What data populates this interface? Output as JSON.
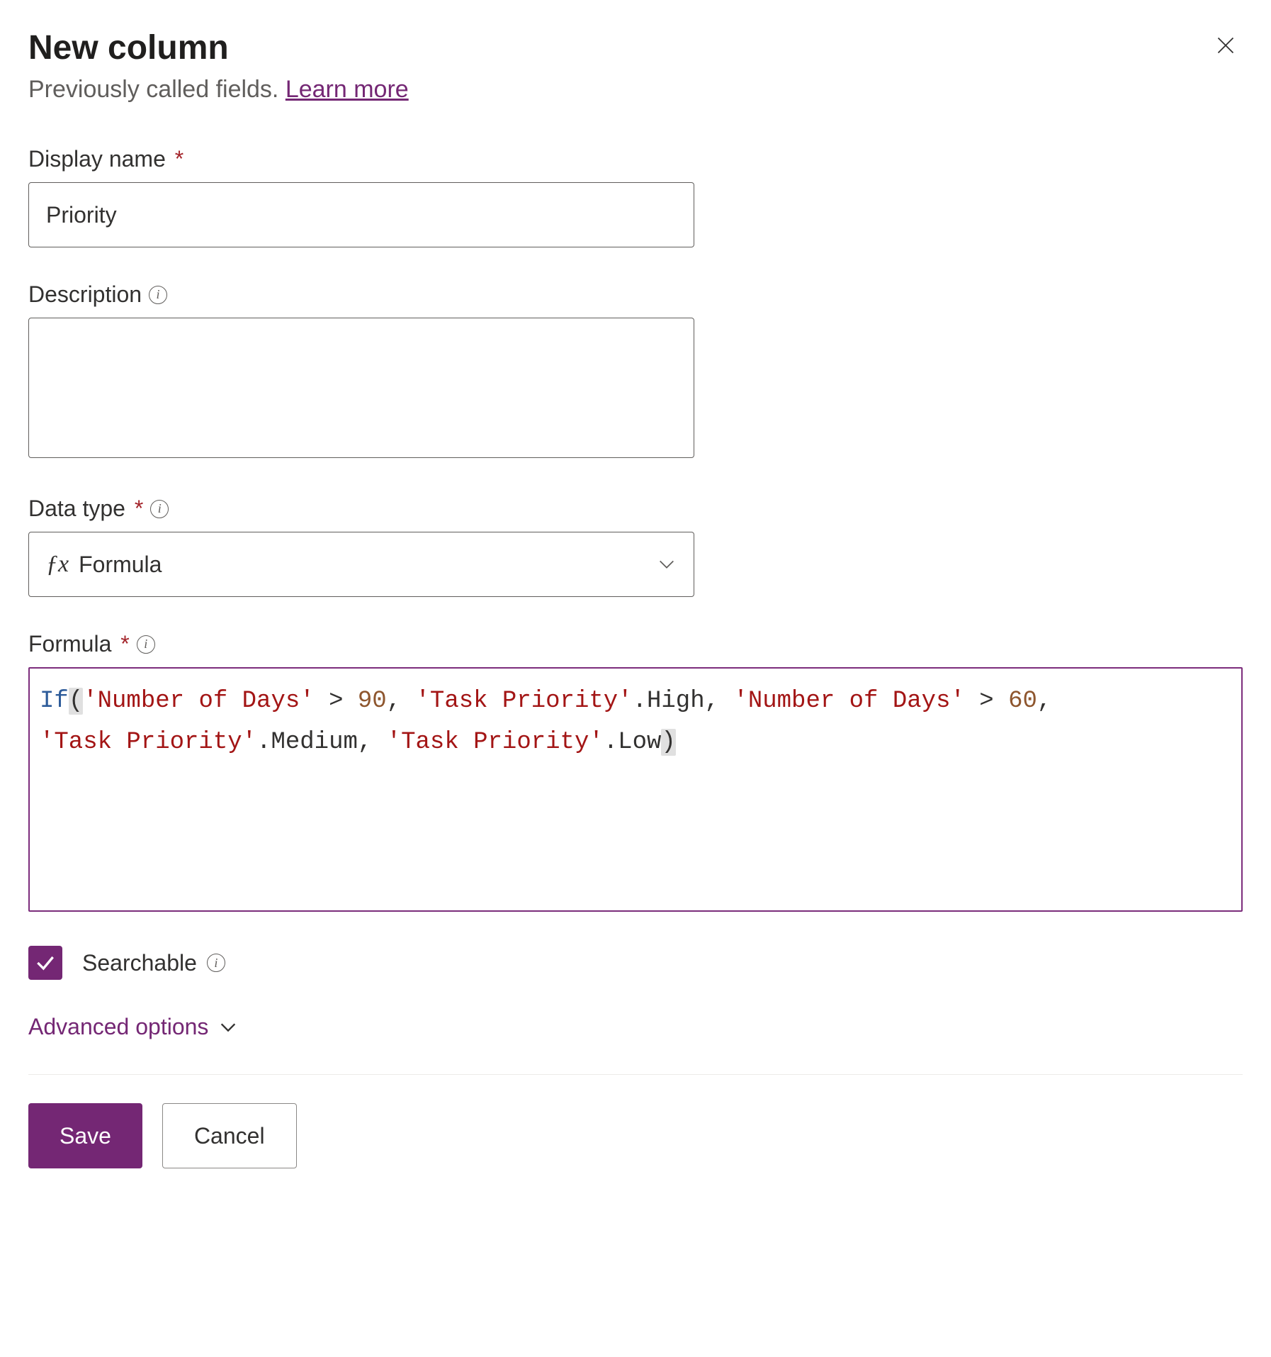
{
  "header": {
    "title": "New column",
    "subtitle_prefix": "Previously called fields. ",
    "learn_more": "Learn more"
  },
  "fields": {
    "display_name": {
      "label": "Display name",
      "value": "Priority"
    },
    "description": {
      "label": "Description",
      "value": ""
    },
    "data_type": {
      "label": "Data type",
      "selected": "Formula"
    },
    "formula": {
      "label": "Formula",
      "tokens": {
        "kw_if": "If",
        "paren_open": "(",
        "str_num_days_1": "'Number of Days'",
        "gt_1": " > ",
        "num_90": "90",
        "comma_1": ", ",
        "str_task_high": "'Task Priority'",
        "dot_high": ".High",
        "comma_2": ", ",
        "str_num_days_2": "'Number of Days'",
        "gt_2": " > ",
        "num_60": "60",
        "comma_3": ", ",
        "str_task_med": "'Task Priority'",
        "dot_med": ".Medium",
        "comma_4": ", ",
        "str_task_low": "'Task Priority'",
        "dot_low": ".Low",
        "paren_close": ")"
      }
    },
    "searchable": {
      "label": "Searchable",
      "checked": true
    },
    "advanced_options": "Advanced options"
  },
  "footer": {
    "save": "Save",
    "cancel": "Cancel"
  }
}
